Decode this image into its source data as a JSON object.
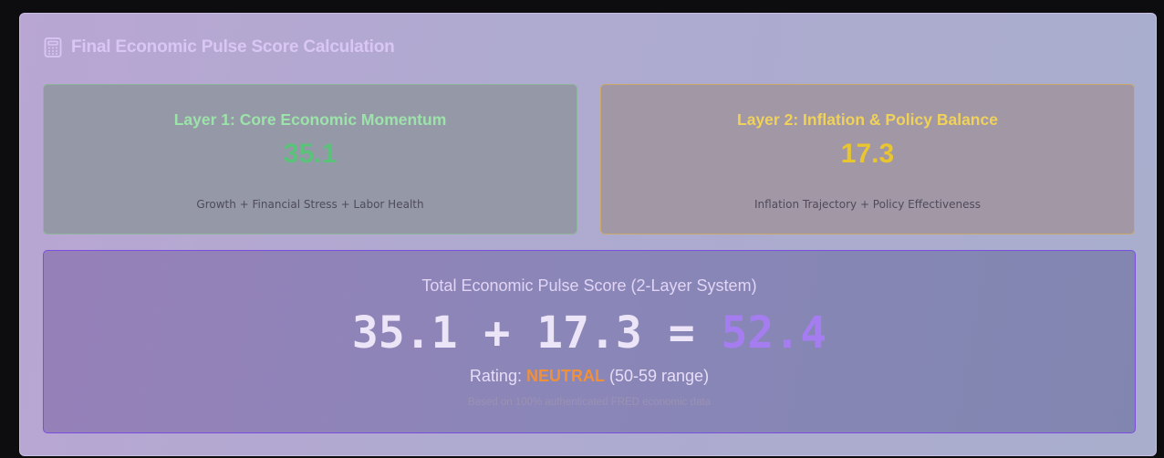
{
  "header": {
    "title": "Final Economic Pulse Score Calculation",
    "icon": "calculator-icon"
  },
  "layers": [
    {
      "title": "Layer 1: Core Economic Momentum",
      "score": "35.1",
      "description": "Growth + Financial Stress + Labor Health",
      "accent": "#5bc27a"
    },
    {
      "title": "Layer 2: Inflation & Policy Balance",
      "score": "17.3",
      "description": "Inflation Trajectory + Policy Effectiveness",
      "accent": "#e9c52f"
    }
  ],
  "total": {
    "label": "Total Economic Pulse Score (2-Layer System)",
    "layer1": "35.1",
    "plus": "+",
    "layer2": "17.3",
    "equals": "=",
    "value": "52.4",
    "rating_prefix": "Rating:",
    "rating": "NEUTRAL",
    "rating_range": "(50-59 range)",
    "source_note": "Based on 100% authenticated FRED economic data",
    "accent": "#a57df0",
    "rating_color": "#f0913a"
  }
}
